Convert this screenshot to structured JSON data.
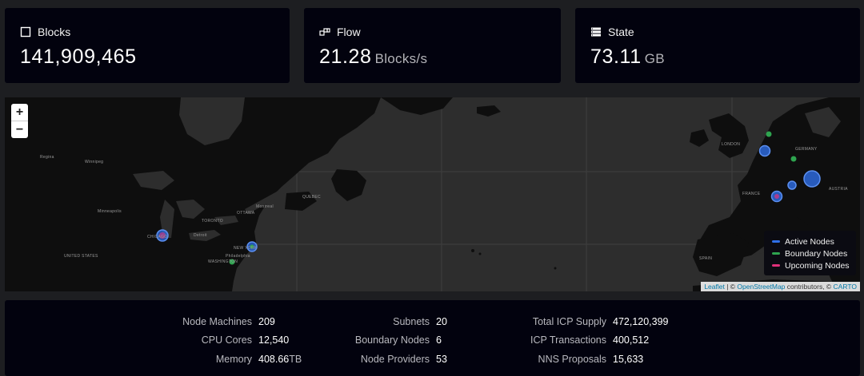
{
  "stats": {
    "blocks": {
      "label": "Blocks",
      "value": "141,909,465",
      "unit": "",
      "icon": "square-icon"
    },
    "flow": {
      "label": "Flow",
      "value": "21.28",
      "unit": "Blocks/s",
      "icon": "flow-icon"
    },
    "state": {
      "label": "State",
      "value": "73.11",
      "unit": "GB",
      "icon": "server-stack-icon"
    }
  },
  "map": {
    "zoom_in": "+",
    "zoom_out": "−",
    "legend": [
      {
        "label": "Active Nodes",
        "color": "#2f6fe8"
      },
      {
        "label": "Boundary Nodes",
        "color": "#2ea44f"
      },
      {
        "label": "Upcoming Nodes",
        "color": "#e0307a"
      }
    ],
    "attribution": {
      "leaflet": "Leaflet",
      "sep": " | © ",
      "osm": "OpenStreetMap",
      "contrib": " contributors, © ",
      "carto": "CARTO"
    },
    "places": {
      "london": "LONDON",
      "germany": "GERMANY",
      "france": "FRANCE",
      "austria": "AUSTRIA",
      "spain": "SPAIN",
      "chicago": "CHICAGO",
      "new_york": "NEW YORK",
      "united_states": "UNITED STATES",
      "philadelphia": "Philadelphia",
      "washington": "WASHINGTON",
      "ottawa": "OTTAWA",
      "toronto": "TORONTO",
      "montreal": "Montreal",
      "quebec": "QUEBEC",
      "minneapolis": "Minneapolis",
      "detroit": "Detroit",
      "winnipeg": "Winnipeg",
      "regina": "Regina"
    }
  },
  "metrics": {
    "col1": [
      {
        "label": "Node Machines",
        "value": "209",
        "unit": ""
      },
      {
        "label": "CPU Cores",
        "value": "12,540",
        "unit": ""
      },
      {
        "label": "Memory",
        "value": "408.66",
        "unit": "TB"
      }
    ],
    "col2": [
      {
        "label": "Subnets",
        "value": "20",
        "unit": ""
      },
      {
        "label": "Boundary Nodes",
        "value": "6",
        "unit": ""
      },
      {
        "label": "Node Providers",
        "value": "53",
        "unit": ""
      }
    ],
    "col3": [
      {
        "label": "Total ICP Supply",
        "value": "472,120,399",
        "unit": ""
      },
      {
        "label": "ICP Transactions",
        "value": "400,512",
        "unit": ""
      },
      {
        "label": "NNS Proposals",
        "value": "15,633",
        "unit": ""
      }
    ]
  }
}
